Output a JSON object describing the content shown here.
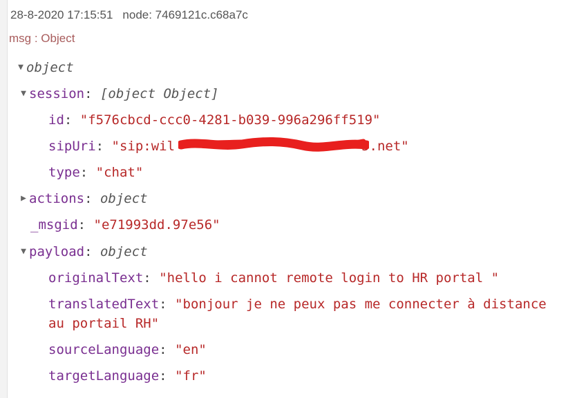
{
  "header": {
    "timestamp": "28-8-2020 17:15:51",
    "node": "node: 7469121c.c68a7c",
    "topic": "msg : Object"
  },
  "tree": {
    "root": {
      "label": "object",
      "expanded": true
    },
    "session": {
      "key": "session",
      "colon": ":",
      "type": {
        "key": "type",
        "colon": ":",
        "value": "\"chat\""
      },
      "expanded": true,
      "id": {
        "key": "id",
        "colon": ":",
        "value": "\"f576cbcd-ccc0-4281-b039-996a296ff519\""
      },
      "sipUri": {
        "key": "sipUri",
        "colon": ":",
        "value": "\"sip:wil",
        "value_end": "5.net\""
      }
    },
    "actions": {
      "key": "actions",
      "colon": ":",
      "type": "object",
      "expanded": false
    },
    "msgid": {
      "key": "_msgid",
      "colon": ":",
      "value": "\"e71993dd.97e56\""
    },
    "payload": {
      "key": "payload",
      "colon": ":",
      "type": "object",
      "expanded": true,
      "originalText": {
        "key": "originalText",
        "colon": ":",
        "value": "\"hello i cannot remote login to HR portal \""
      },
      "translatedText": {
        "key": "translatedText",
        "colon": ":",
        "value": "\"bonjour je ne peux pas me connecter à distance",
        "value_line2": "au portail RH\""
      },
      "sourceLanguage": {
        "key": "sourceLanguage",
        "colon": ":",
        "value": "\"en\""
      },
      "targetLanguage": {
        "key": "targetLanguage",
        "colon": ":",
        "value": "\"fr\""
      }
    }
  },
  "icons": {
    "expanded": "caret-down-icon",
    "collapsed": "caret-right-icon"
  },
  "colors": {
    "key": "#792e90",
    "string": "#b72828",
    "redaction": "#e8201e"
  }
}
